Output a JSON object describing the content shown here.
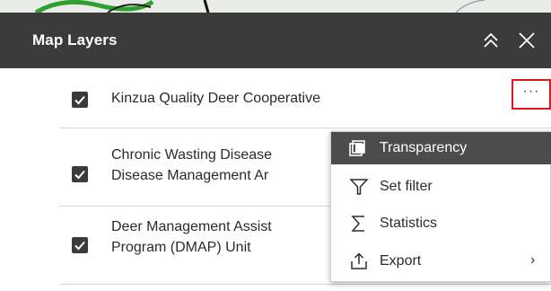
{
  "panel": {
    "title": "Map Layers"
  },
  "layers": [
    {
      "line1": "Kinzua Quality Deer Cooperative",
      "line2": "",
      "checked": true
    },
    {
      "line1": "Chronic Wasting Disease",
      "line2": "Disease Management Ar",
      "checked": true
    },
    {
      "line1": "Deer Management Assist",
      "line2": "Program (DMAP) Unit",
      "checked": true
    }
  ],
  "options_button": {
    "label": "···"
  },
  "menu": {
    "items": [
      {
        "label": "Transparency",
        "icon": "transparency-icon",
        "active": true
      },
      {
        "label": "Set filter",
        "icon": "filter-icon"
      },
      {
        "label": "Statistics",
        "icon": "sigma-icon"
      },
      {
        "label": "Export",
        "icon": "export-icon",
        "chevron": "›"
      }
    ]
  },
  "colors": {
    "header_bg": "#3b3b3b",
    "highlight_border": "#e0161b",
    "menu_active_bg": "#4c4c4c"
  }
}
